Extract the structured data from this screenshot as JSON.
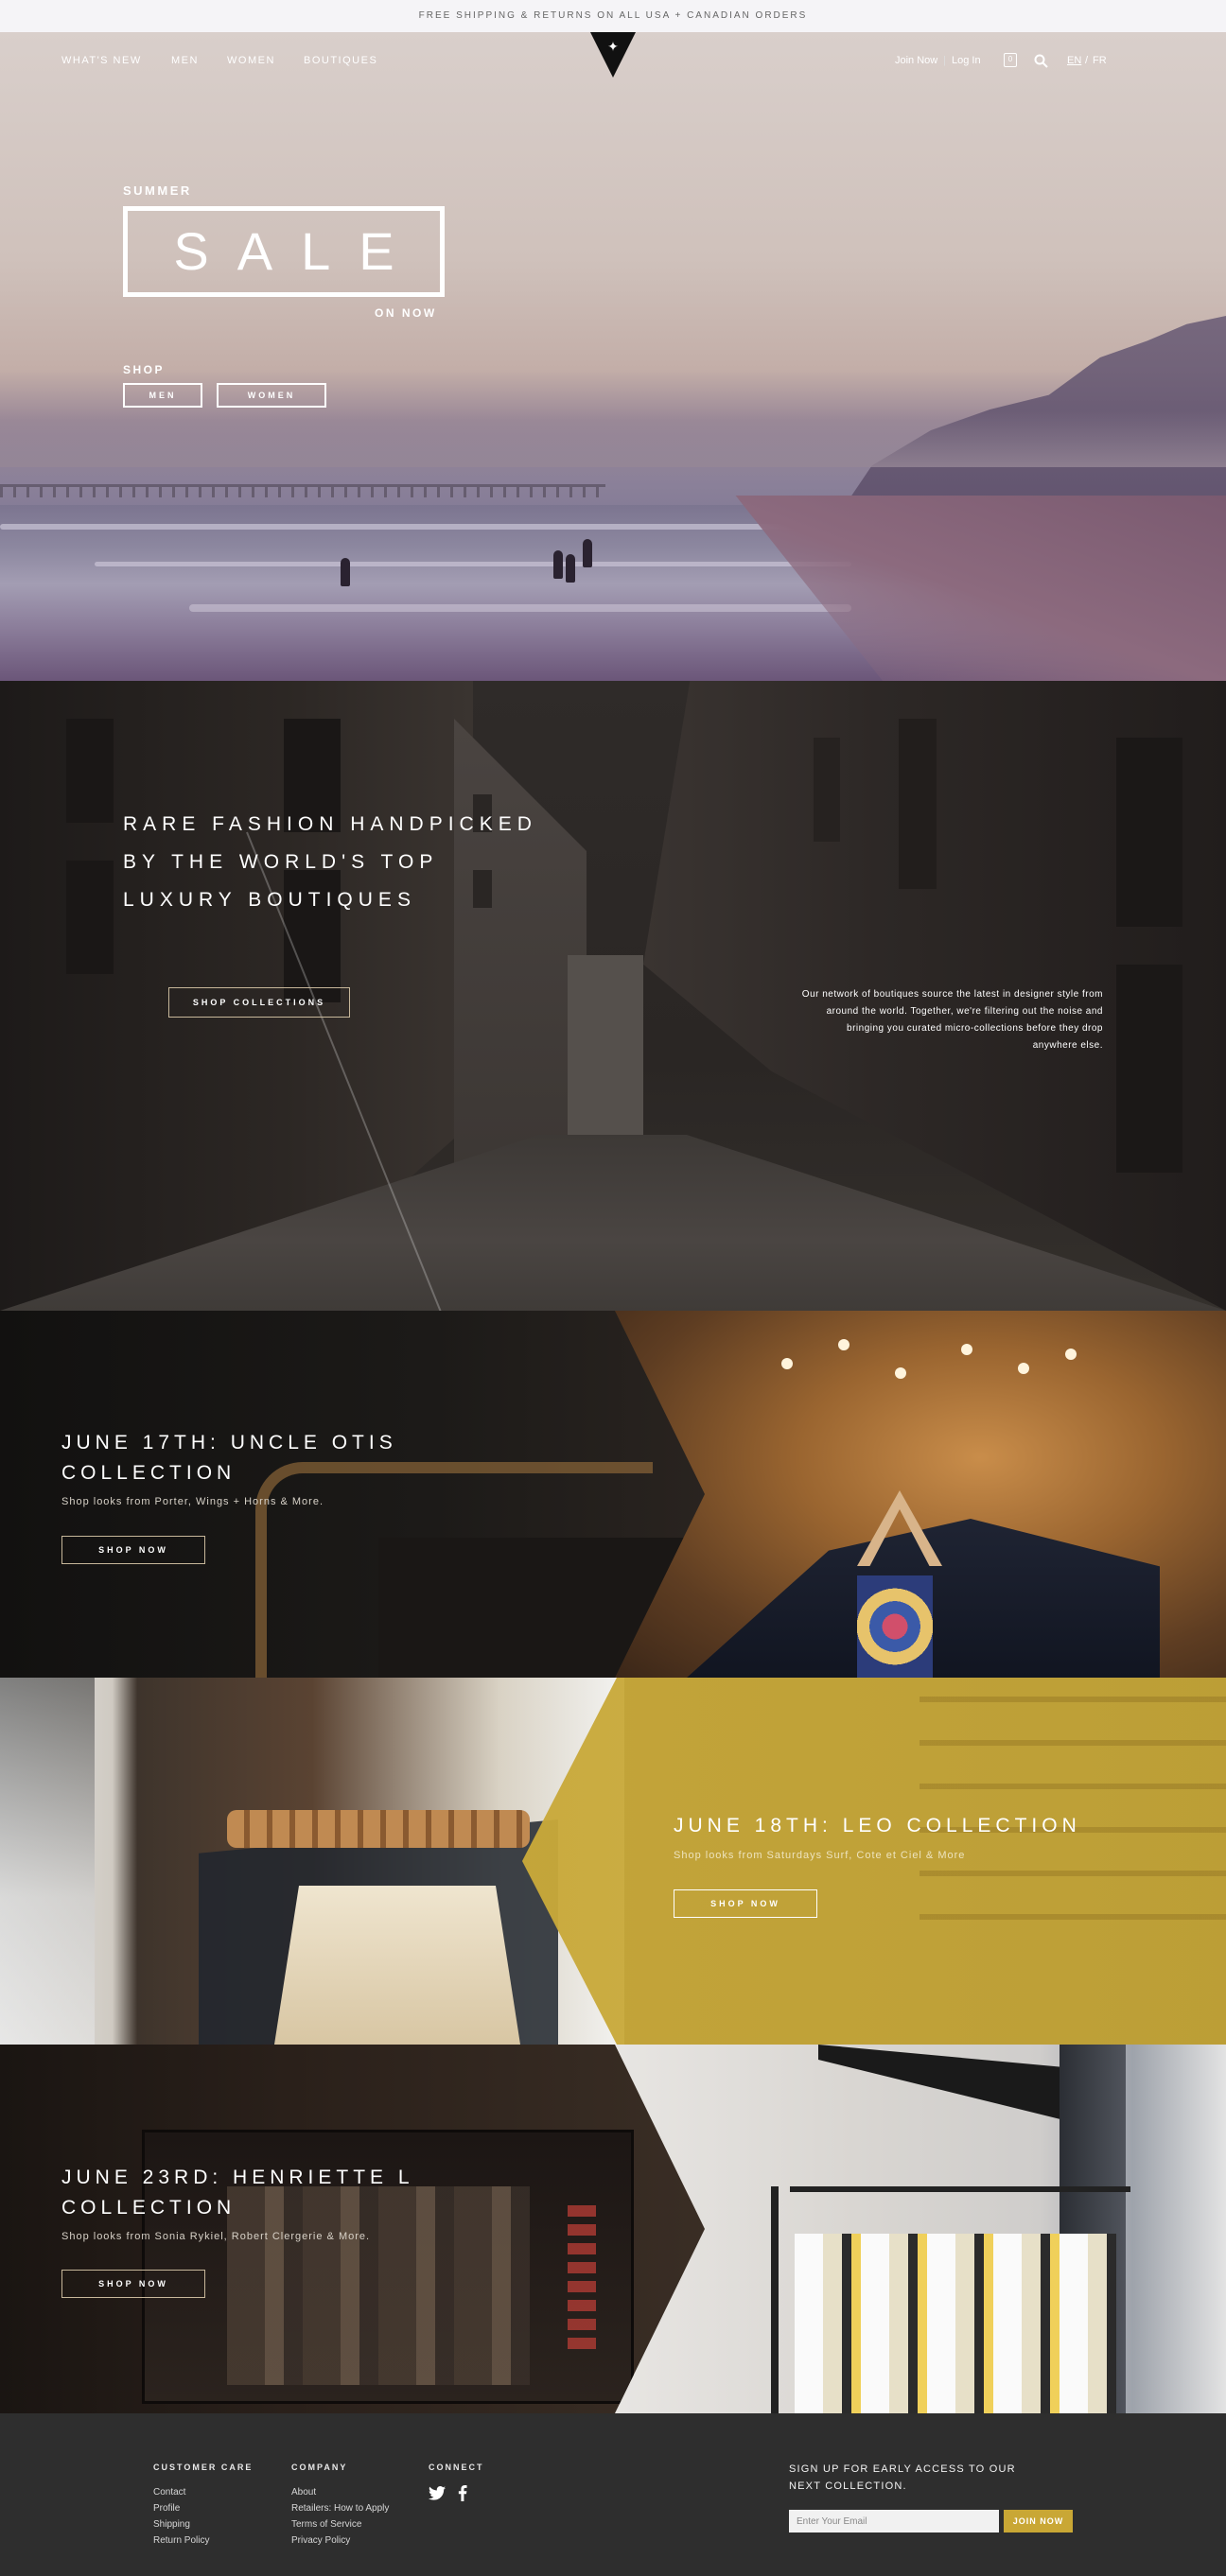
{
  "announcement": "FREE SHIPPING & RETURNS ON ALL USA + CANADIAN ORDERS",
  "nav": {
    "items": [
      "WHAT'S NEW",
      "MEN",
      "WOMEN",
      "BOUTIQUES"
    ],
    "join": "Join Now",
    "divider": "|",
    "login": "Log In",
    "cart_count": "0",
    "lang_en": "EN",
    "lang_sep": "/",
    "lang_fr": "FR"
  },
  "hero": {
    "kicker": "SUMMER",
    "title": "SALE",
    "on_now": "ON NOW",
    "shop_label": "SHOP",
    "btn_men": "MEN",
    "btn_women": "WOMEN"
  },
  "boutiques": {
    "title_lines": [
      "RARE FASHION HANDPICKED",
      "BY THE WORLD'S TOP",
      "LUXURY BOUTIQUES"
    ],
    "button": "SHOP COLLECTIONS",
    "description_lines": [
      "Our network of boutiques source the latest in designer style from",
      "around the world. Together, we're filtering out the noise and",
      "bringing you curated micro-collections before they drop",
      "anywhere else."
    ]
  },
  "collections": [
    {
      "title_lines": [
        "JUNE 17TH: UNCLE OTIS",
        "COLLECTION"
      ],
      "subtitle": "Shop looks from Porter, Wings + Horns & More.",
      "button": "SHOP NOW"
    },
    {
      "title_lines": [
        "JUNE 18TH: LEO COLLECTION"
      ],
      "subtitle": "Shop looks from Saturdays Surf, Cote et Ciel & More",
      "button": "SHOP NOW"
    },
    {
      "title_lines": [
        "JUNE 23RD: HENRIETTE L",
        "COLLECTION"
      ],
      "subtitle": "Shop looks from Sonia Rykiel, Robert Clergerie & More.",
      "button": "SHOP NOW"
    }
  ],
  "footer": {
    "customer_care": {
      "heading": "CUSTOMER CARE",
      "links": [
        "Contact",
        "Profile",
        "Shipping",
        "Return Policy"
      ]
    },
    "company": {
      "heading": "COMPANY",
      "links": [
        "About",
        "Retailers: How to Apply",
        "Terms of Service",
        "Privacy Policy"
      ]
    },
    "connect": {
      "heading": "CONNECT",
      "icons": [
        "twitter-icon",
        "facebook-icon"
      ]
    },
    "signup_text": "SIGN UP FOR EARLY ACCESS TO OUR NEXT COLLECTION.",
    "email_placeholder": "Enter Your Email",
    "join_button": "JOIN NOW"
  },
  "colors": {
    "accent_gold": "#c9a735",
    "footer_bg": "#2e2e2e",
    "mustard_panel": "#c7a93a"
  }
}
